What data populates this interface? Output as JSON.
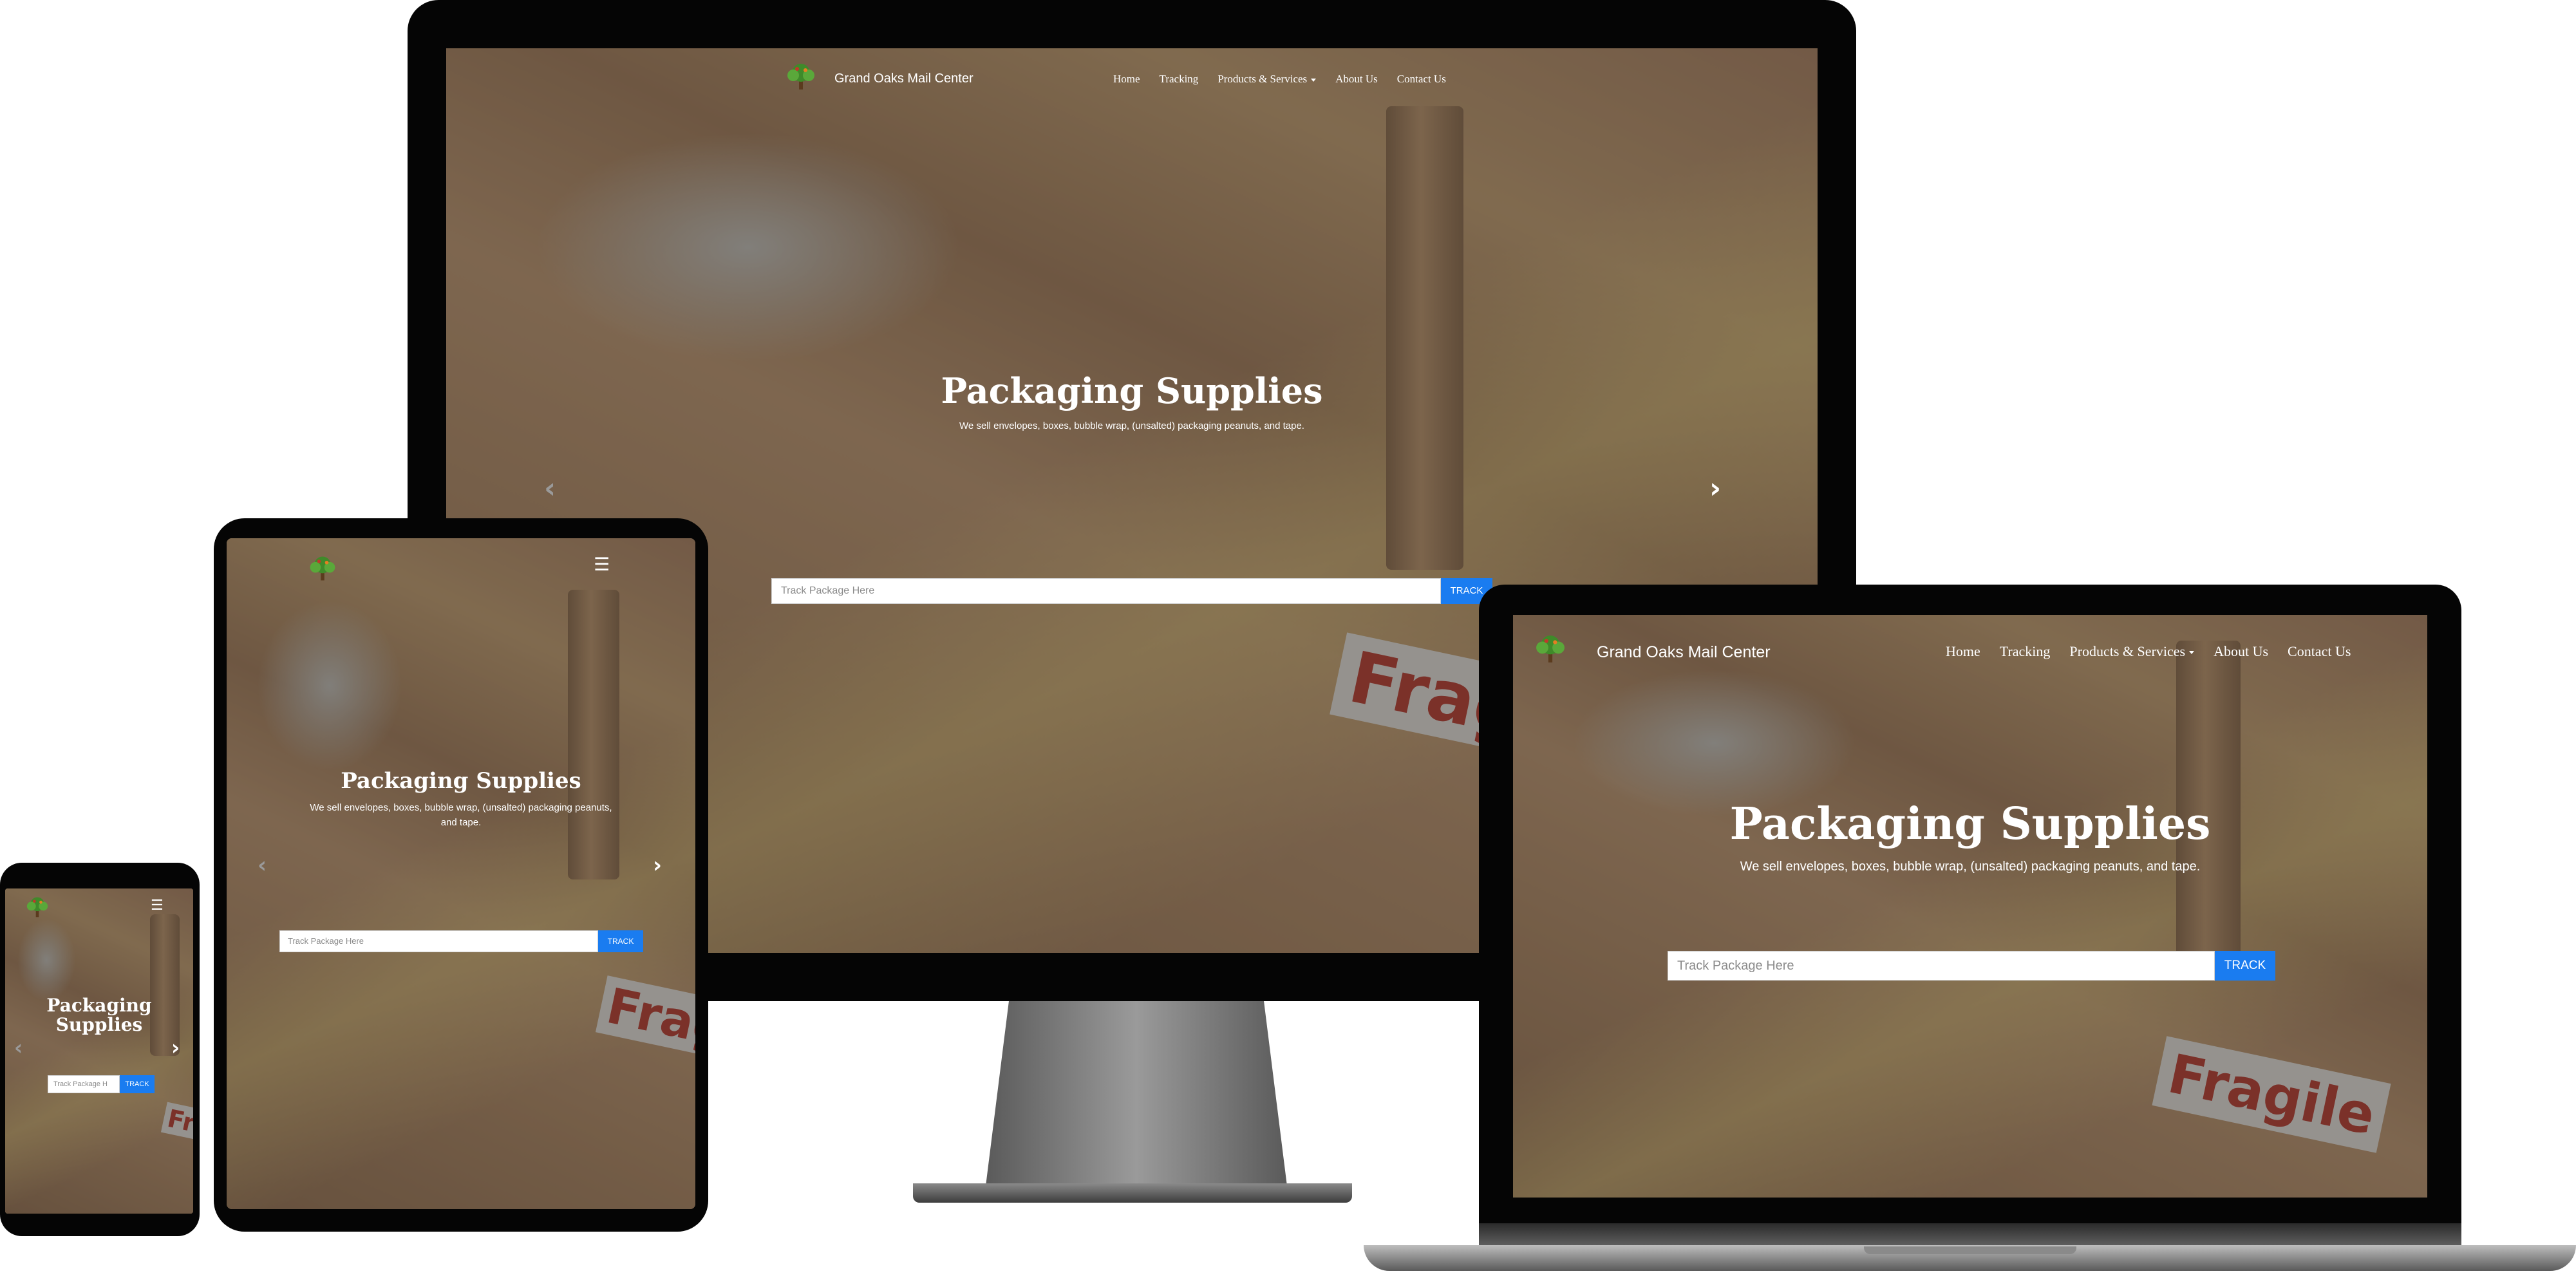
{
  "site": {
    "brand": "Grand Oaks Mail Center",
    "nav": {
      "home": "Home",
      "tracking": "Tracking",
      "products": "Products & Services",
      "about": "About Us",
      "contact": "Contact Us"
    },
    "hero": {
      "title": "Packaging Supplies",
      "title_line1": "Packaging",
      "title_line2": "Supplies",
      "subtitle": "We sell envelopes, boxes, bubble wrap, (unsalted) packaging peanuts, and tape.",
      "subtitle_line1": "We sell envelopes, boxes, bubble wrap, (unsalted) packaging peanuts,",
      "subtitle_line2": "and tape."
    },
    "search": {
      "placeholder": "Track Package Here",
      "placeholder_phone": "Track Package H",
      "button": "TRACK"
    },
    "photo_label": "Fragile",
    "photo_label_short": "Frag",
    "photo_label_tiny": "Fr",
    "icons": {
      "logo": "tree-logo-icon",
      "menu": "hamburger-menu-icon",
      "prev": "chevron-left-icon",
      "next": "chevron-right-icon"
    },
    "glyphs": {
      "menu": "☰",
      "prev": "‹",
      "next": "›"
    },
    "colors": {
      "accent": "#1a7cf0",
      "device": "#050505",
      "overlay": "rgba(40,40,40,0.45)"
    }
  }
}
